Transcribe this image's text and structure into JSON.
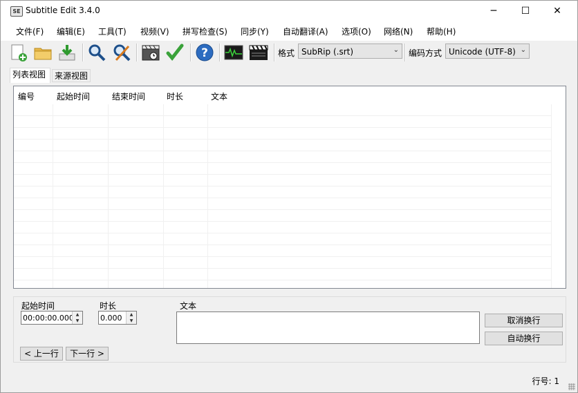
{
  "window": {
    "title": "Subtitle Edit 3.4.0",
    "app_icon_text": "SE",
    "minimize": "─",
    "maximize": "☐",
    "close": "✕"
  },
  "menu": {
    "items": [
      "文件(F)",
      "编辑(E)",
      "工具(T)",
      "视频(V)",
      "拼写检查(S)",
      "同步(Y)",
      "自动翻译(A)",
      "选项(O)",
      "网络(N)",
      "帮助(H)"
    ]
  },
  "toolbar": {
    "icons": [
      "new-file-icon",
      "open-folder-icon",
      "save-download-icon",
      "find-icon",
      "replace-icon",
      "visual-sync-icon",
      "spell-check-icon",
      "help-icon",
      "waveform-icon",
      "video-clapper-icon"
    ],
    "format_label": "格式",
    "format_value": "SubRip (.srt)",
    "encoding_label": "编码方式",
    "encoding_value": "Unicode (UTF-8)"
  },
  "tabs": {
    "list_view": "列表视图",
    "source_view": "来源视图"
  },
  "table": {
    "columns": [
      "编号",
      "起始时间",
      "结束时间",
      "时长",
      "文本"
    ],
    "rows": []
  },
  "edit": {
    "start_time_label": "起始时间",
    "start_time_value": "00:00:00.000",
    "duration_label": "时长",
    "duration_value": "0.000",
    "text_label": "文本",
    "text_value": "",
    "unbreak_button": "取消换行",
    "auto_break_button": "自动换行",
    "prev_button": "< 上一行",
    "next_button": "下一行 >"
  },
  "status": {
    "line_number": "行号: 1"
  }
}
